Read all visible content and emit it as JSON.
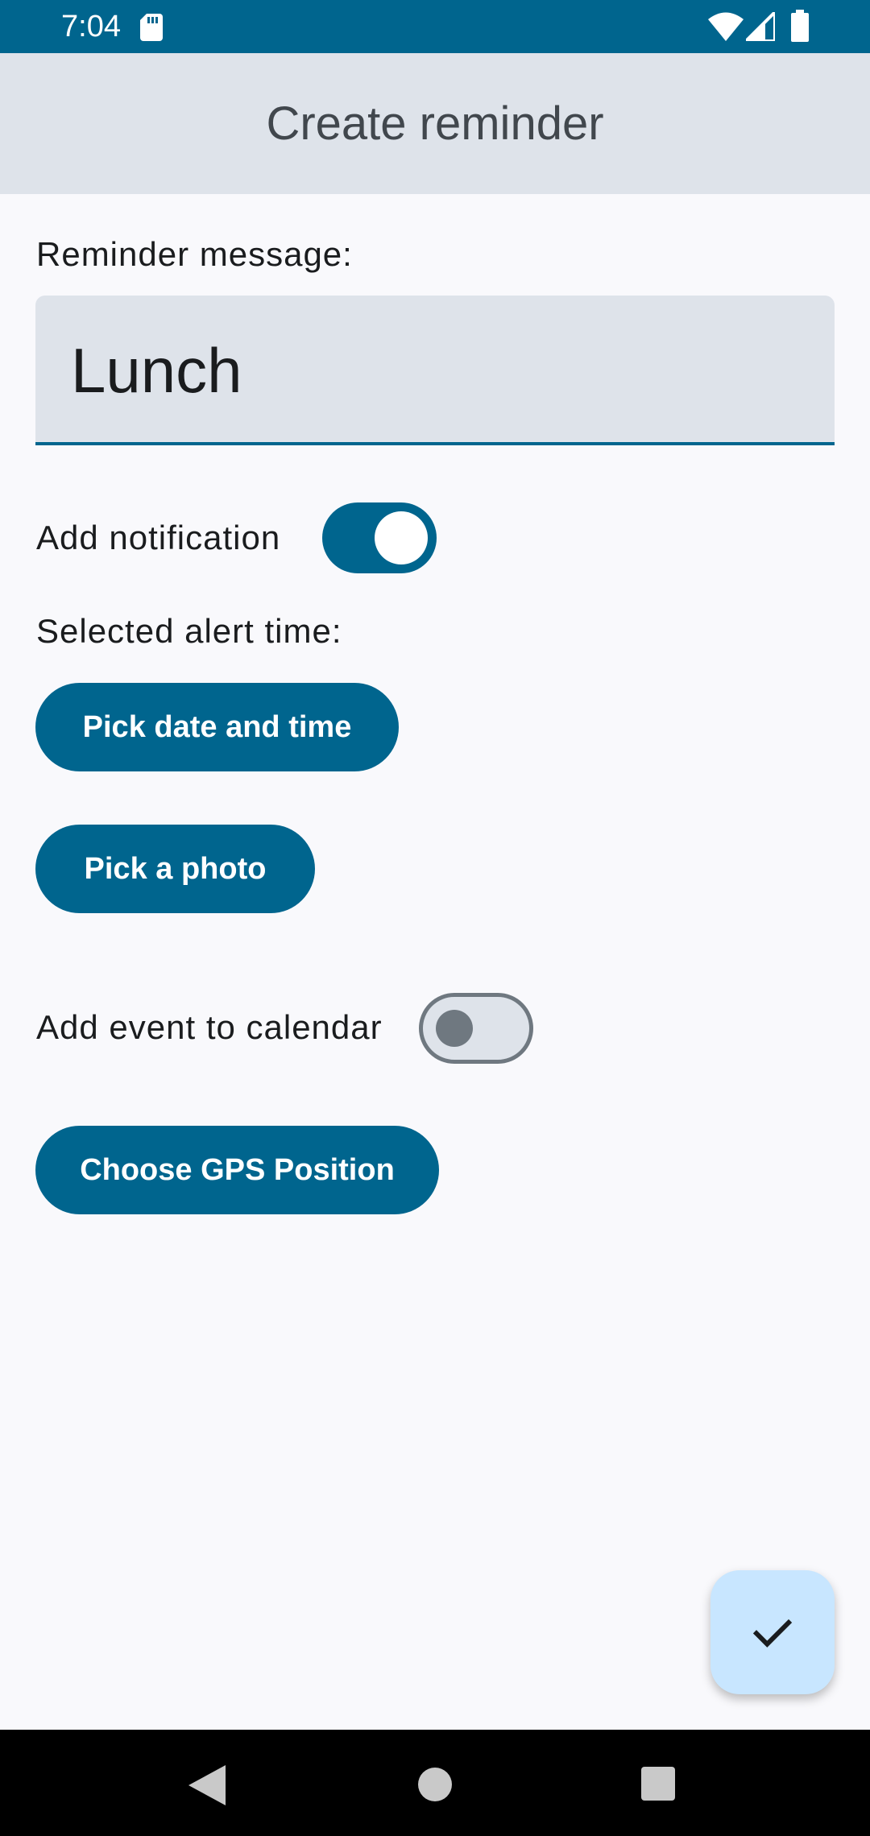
{
  "status_bar": {
    "time": "7:04",
    "icons": [
      "sd-card-icon",
      "wifi-icon",
      "cell-signal-icon",
      "battery-icon"
    ]
  },
  "app_bar": {
    "title": "Create reminder"
  },
  "form": {
    "message_label": "Reminder message:",
    "message_value": "Lunch",
    "notification_label": "Add notification",
    "notification_enabled": true,
    "alert_time_label": "Selected alert time:",
    "pick_datetime_button": "Pick date and time",
    "pick_photo_button": "Pick a photo",
    "calendar_label": "Add event to calendar",
    "calendar_enabled": false,
    "gps_button": "Choose GPS Position"
  },
  "fab": {
    "icon": "check-icon"
  },
  "nav_bar": {
    "icons": [
      "back-icon",
      "home-icon",
      "recents-icon"
    ]
  },
  "colors": {
    "primary": "#00658e",
    "surface": "#f9f9fc",
    "surface_variant": "#dee3ea",
    "fab_container": "#c8e6ff"
  }
}
